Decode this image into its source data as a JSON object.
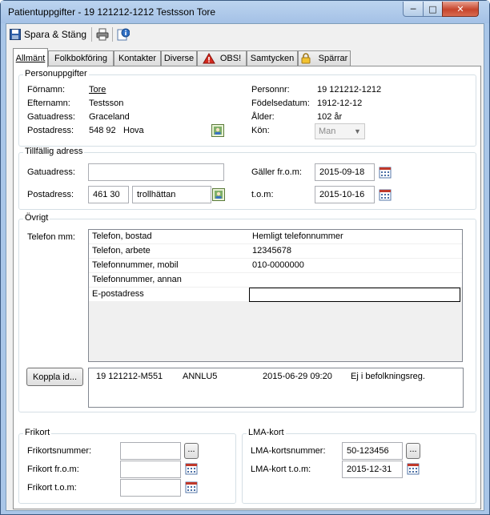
{
  "window": {
    "title": "Patientuppgifter - 19  121212-1212 Testsson Tore"
  },
  "toolbar": {
    "save_close_label": "Spara & Stäng"
  },
  "tabs": [
    {
      "label": "Allmänt"
    },
    {
      "label": "Folkbokföring"
    },
    {
      "label": "Kontakter"
    },
    {
      "label": "Diverse"
    },
    {
      "label": "OBS!"
    },
    {
      "label": "Samtycken"
    },
    {
      "label": "Spärrar"
    }
  ],
  "personuppgifter": {
    "title": "Personuppgifter",
    "fornamn_label": "Förnamn:",
    "fornamn": "Tore",
    "efternamn_label": "Efternamn:",
    "efternamn": "Testsson",
    "gatuadress_label": "Gatuadress:",
    "gatuadress": "Graceland",
    "postadress_label": "Postadress:",
    "postnummer": "548 92",
    "ort": "Hova",
    "personnr_label": "Personnr:",
    "personnr": "19  121212-1212",
    "fodelsedatum_label": "Födelsedatum:",
    "fodelsedatum": "1912-12-12",
    "alder_label": "Ålder:",
    "alder": "102 år",
    "kon_label": "Kön:",
    "kon": "Man"
  },
  "tillfallig": {
    "title": "Tillfällig adress",
    "gatuadress_label": "Gatuadress:",
    "gatuadress": "",
    "postadress_label": "Postadress:",
    "postnummer": "461 30",
    "ort": "trollhättan",
    "galler_from_label": "Gäller fr.o.m:",
    "galler_from": "2015-09-18",
    "tom_label": "t.o.m:",
    "tom": "2015-10-16"
  },
  "ovrigt": {
    "title": "Övrigt",
    "telefon_label": "Telefon mm:",
    "phones": [
      {
        "type": "Telefon, bostad",
        "value": "Hemligt telefonnummer"
      },
      {
        "type": "Telefon, arbete",
        "value": "12345678"
      },
      {
        "type": "Telefonnummer, mobil",
        "value": "010-0000000"
      },
      {
        "type": "Telefonnummer, annan",
        "value": ""
      },
      {
        "type": "E-postadress",
        "value": ""
      }
    ],
    "koppla_label": "Koppla id...",
    "linked": {
      "pnr": "19  121212-M551",
      "code": "ANNLU5",
      "datetime": "2015-06-29 09:20",
      "status": "Ej i befolkningsreg."
    }
  },
  "frikort": {
    "title": "Frikort",
    "nummer_label": "Frikortsnummer:",
    "nummer": "",
    "from_label": "Frikort fr.o.m:",
    "from": "",
    "tom_label": "Frikort t.o.m:",
    "tom": ""
  },
  "lma": {
    "title": "LMA-kort",
    "nummer_label": "LMA-kortsnummer:",
    "nummer": "50-123456",
    "tom_label": "LMA-kort t.o.m:",
    "tom": "2015-12-31"
  },
  "colors": {
    "titlebar": "#a9c6e8",
    "panel": "#ffffff",
    "border": "#8e8f8f"
  },
  "icons": [
    "save-icon",
    "print-icon",
    "info-icon",
    "warning-icon",
    "lock-icon",
    "calendar-icon",
    "address-book-icon"
  ]
}
